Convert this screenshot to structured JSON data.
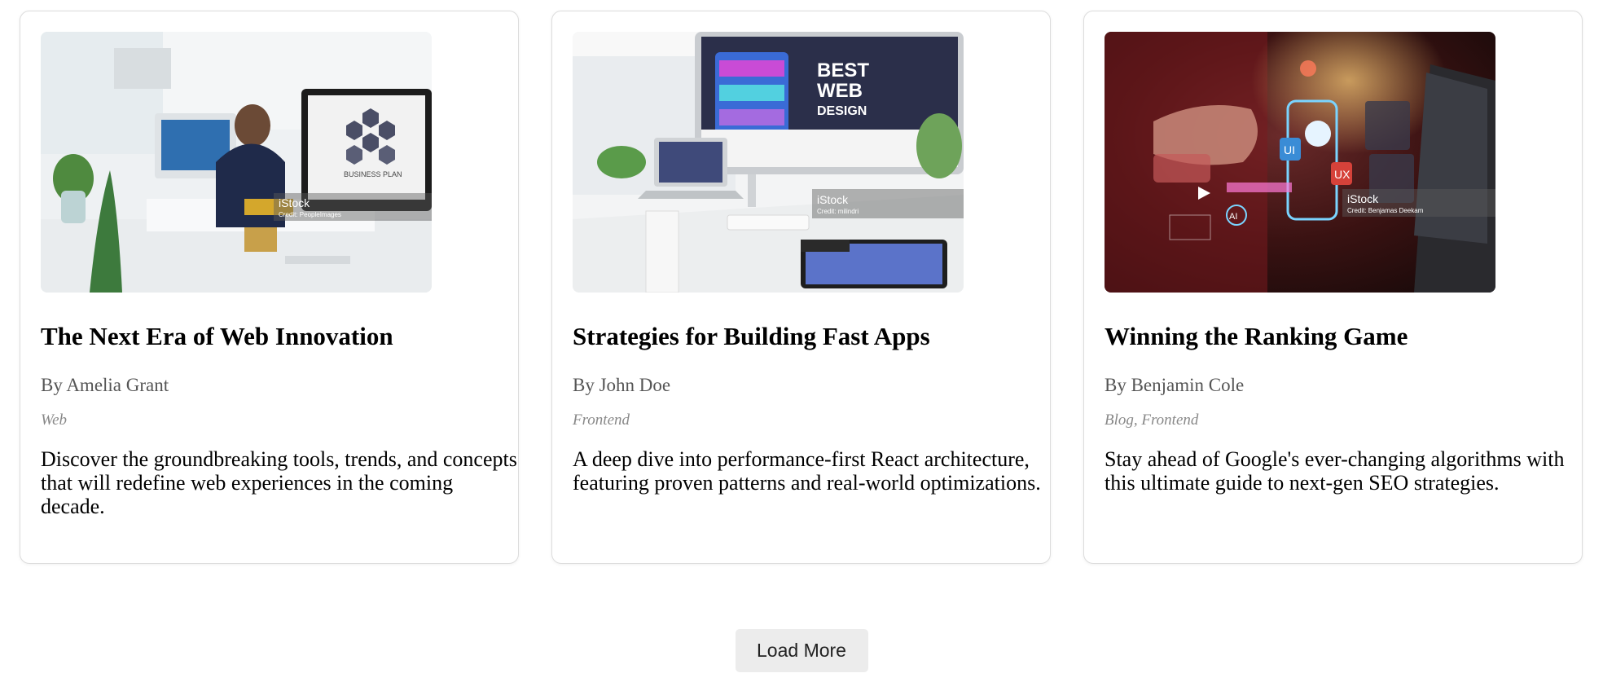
{
  "posts": [
    {
      "title": "The Next Era of Web Innovation",
      "author": "By Amelia Grant",
      "tags": "Web",
      "description": "Discover the groundbreaking tools, trends, and concepts that will redefine web experiences in the coming decade.",
      "image": {
        "watermark": "iStock",
        "credit": "Credit: PeopleImages",
        "poster_text": "BUSINESS PLAN"
      }
    },
    {
      "title": "Strategies for Building Fast Apps",
      "author": "By John Doe",
      "tags": "Frontend",
      "description": "A deep dive into performance-first React architecture, featuring proven patterns and real-world optimizations.",
      "image": {
        "watermark": "iStock",
        "credit": "Credit: milindri",
        "poster_text_1": "BEST",
        "poster_text_2": "WEB",
        "poster_text_3": "DESIGN"
      }
    },
    {
      "title": "Winning the Ranking Game",
      "author": "By Benjamin Cole",
      "tags": "Blog, Frontend",
      "description": "Stay ahead of Google's ever-changing algorithms with this ultimate guide to next-gen SEO strategies.",
      "image": {
        "watermark": "iStock",
        "credit": "Credit: Benjamas Deekam",
        "ui_label": "UI",
        "ux_label": "UX",
        "ai_label": "AI"
      }
    }
  ],
  "load_more_label": "Load More"
}
